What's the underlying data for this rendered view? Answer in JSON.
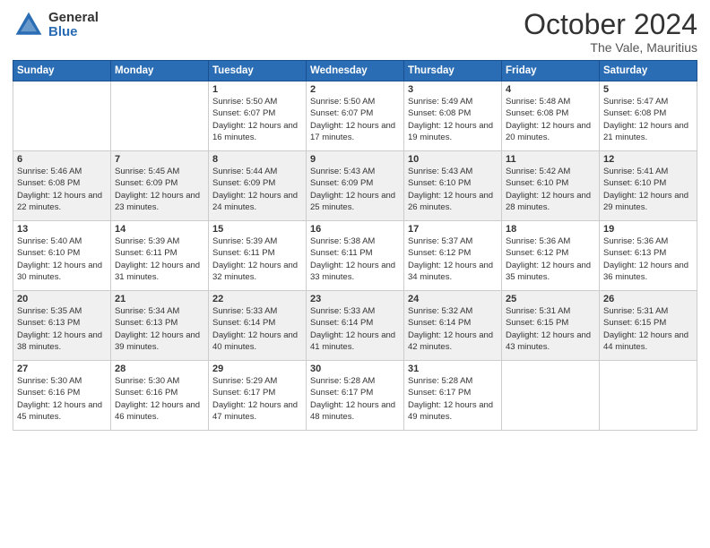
{
  "logo": {
    "general": "General",
    "blue": "Blue"
  },
  "header": {
    "month": "October 2024",
    "location": "The Vale, Mauritius"
  },
  "days_of_week": [
    "Sunday",
    "Monday",
    "Tuesday",
    "Wednesday",
    "Thursday",
    "Friday",
    "Saturday"
  ],
  "weeks": [
    [
      {
        "day": "",
        "sunrise": "",
        "sunset": "",
        "daylight": ""
      },
      {
        "day": "",
        "sunrise": "",
        "sunset": "",
        "daylight": ""
      },
      {
        "day": "1",
        "sunrise": "Sunrise: 5:50 AM",
        "sunset": "Sunset: 6:07 PM",
        "daylight": "Daylight: 12 hours and 16 minutes."
      },
      {
        "day": "2",
        "sunrise": "Sunrise: 5:50 AM",
        "sunset": "Sunset: 6:07 PM",
        "daylight": "Daylight: 12 hours and 17 minutes."
      },
      {
        "day": "3",
        "sunrise": "Sunrise: 5:49 AM",
        "sunset": "Sunset: 6:08 PM",
        "daylight": "Daylight: 12 hours and 19 minutes."
      },
      {
        "day": "4",
        "sunrise": "Sunrise: 5:48 AM",
        "sunset": "Sunset: 6:08 PM",
        "daylight": "Daylight: 12 hours and 20 minutes."
      },
      {
        "day": "5",
        "sunrise": "Sunrise: 5:47 AM",
        "sunset": "Sunset: 6:08 PM",
        "daylight": "Daylight: 12 hours and 21 minutes."
      }
    ],
    [
      {
        "day": "6",
        "sunrise": "Sunrise: 5:46 AM",
        "sunset": "Sunset: 6:08 PM",
        "daylight": "Daylight: 12 hours and 22 minutes."
      },
      {
        "day": "7",
        "sunrise": "Sunrise: 5:45 AM",
        "sunset": "Sunset: 6:09 PM",
        "daylight": "Daylight: 12 hours and 23 minutes."
      },
      {
        "day": "8",
        "sunrise": "Sunrise: 5:44 AM",
        "sunset": "Sunset: 6:09 PM",
        "daylight": "Daylight: 12 hours and 24 minutes."
      },
      {
        "day": "9",
        "sunrise": "Sunrise: 5:43 AM",
        "sunset": "Sunset: 6:09 PM",
        "daylight": "Daylight: 12 hours and 25 minutes."
      },
      {
        "day": "10",
        "sunrise": "Sunrise: 5:43 AM",
        "sunset": "Sunset: 6:10 PM",
        "daylight": "Daylight: 12 hours and 26 minutes."
      },
      {
        "day": "11",
        "sunrise": "Sunrise: 5:42 AM",
        "sunset": "Sunset: 6:10 PM",
        "daylight": "Daylight: 12 hours and 28 minutes."
      },
      {
        "day": "12",
        "sunrise": "Sunrise: 5:41 AM",
        "sunset": "Sunset: 6:10 PM",
        "daylight": "Daylight: 12 hours and 29 minutes."
      }
    ],
    [
      {
        "day": "13",
        "sunrise": "Sunrise: 5:40 AM",
        "sunset": "Sunset: 6:10 PM",
        "daylight": "Daylight: 12 hours and 30 minutes."
      },
      {
        "day": "14",
        "sunrise": "Sunrise: 5:39 AM",
        "sunset": "Sunset: 6:11 PM",
        "daylight": "Daylight: 12 hours and 31 minutes."
      },
      {
        "day": "15",
        "sunrise": "Sunrise: 5:39 AM",
        "sunset": "Sunset: 6:11 PM",
        "daylight": "Daylight: 12 hours and 32 minutes."
      },
      {
        "day": "16",
        "sunrise": "Sunrise: 5:38 AM",
        "sunset": "Sunset: 6:11 PM",
        "daylight": "Daylight: 12 hours and 33 minutes."
      },
      {
        "day": "17",
        "sunrise": "Sunrise: 5:37 AM",
        "sunset": "Sunset: 6:12 PM",
        "daylight": "Daylight: 12 hours and 34 minutes."
      },
      {
        "day": "18",
        "sunrise": "Sunrise: 5:36 AM",
        "sunset": "Sunset: 6:12 PM",
        "daylight": "Daylight: 12 hours and 35 minutes."
      },
      {
        "day": "19",
        "sunrise": "Sunrise: 5:36 AM",
        "sunset": "Sunset: 6:13 PM",
        "daylight": "Daylight: 12 hours and 36 minutes."
      }
    ],
    [
      {
        "day": "20",
        "sunrise": "Sunrise: 5:35 AM",
        "sunset": "Sunset: 6:13 PM",
        "daylight": "Daylight: 12 hours and 38 minutes."
      },
      {
        "day": "21",
        "sunrise": "Sunrise: 5:34 AM",
        "sunset": "Sunset: 6:13 PM",
        "daylight": "Daylight: 12 hours and 39 minutes."
      },
      {
        "day": "22",
        "sunrise": "Sunrise: 5:33 AM",
        "sunset": "Sunset: 6:14 PM",
        "daylight": "Daylight: 12 hours and 40 minutes."
      },
      {
        "day": "23",
        "sunrise": "Sunrise: 5:33 AM",
        "sunset": "Sunset: 6:14 PM",
        "daylight": "Daylight: 12 hours and 41 minutes."
      },
      {
        "day": "24",
        "sunrise": "Sunrise: 5:32 AM",
        "sunset": "Sunset: 6:14 PM",
        "daylight": "Daylight: 12 hours and 42 minutes."
      },
      {
        "day": "25",
        "sunrise": "Sunrise: 5:31 AM",
        "sunset": "Sunset: 6:15 PM",
        "daylight": "Daylight: 12 hours and 43 minutes."
      },
      {
        "day": "26",
        "sunrise": "Sunrise: 5:31 AM",
        "sunset": "Sunset: 6:15 PM",
        "daylight": "Daylight: 12 hours and 44 minutes."
      }
    ],
    [
      {
        "day": "27",
        "sunrise": "Sunrise: 5:30 AM",
        "sunset": "Sunset: 6:16 PM",
        "daylight": "Daylight: 12 hours and 45 minutes."
      },
      {
        "day": "28",
        "sunrise": "Sunrise: 5:30 AM",
        "sunset": "Sunset: 6:16 PM",
        "daylight": "Daylight: 12 hours and 46 minutes."
      },
      {
        "day": "29",
        "sunrise": "Sunrise: 5:29 AM",
        "sunset": "Sunset: 6:17 PM",
        "daylight": "Daylight: 12 hours and 47 minutes."
      },
      {
        "day": "30",
        "sunrise": "Sunrise: 5:28 AM",
        "sunset": "Sunset: 6:17 PM",
        "daylight": "Daylight: 12 hours and 48 minutes."
      },
      {
        "day": "31",
        "sunrise": "Sunrise: 5:28 AM",
        "sunset": "Sunset: 6:17 PM",
        "daylight": "Daylight: 12 hours and 49 minutes."
      },
      {
        "day": "",
        "sunrise": "",
        "sunset": "",
        "daylight": ""
      },
      {
        "day": "",
        "sunrise": "",
        "sunset": "",
        "daylight": ""
      }
    ]
  ]
}
